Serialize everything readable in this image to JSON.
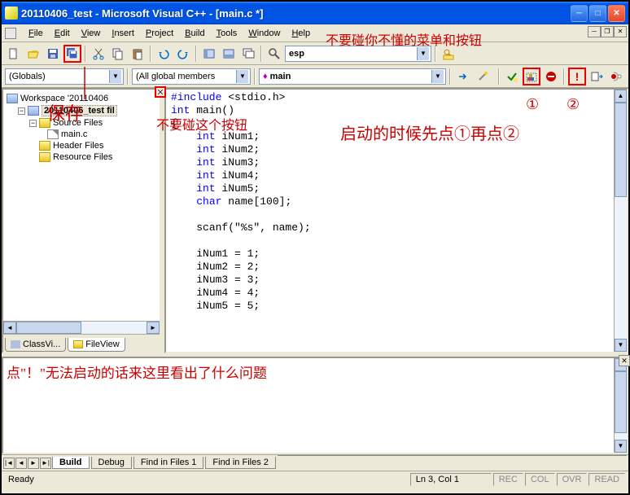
{
  "title": "20110406_test - Microsoft Visual C++ - [main.c *]",
  "menus": [
    "File",
    "Edit",
    "View",
    "Insert",
    "Project",
    "Build",
    "Tools",
    "Window",
    "Help"
  ],
  "annot": {
    "menu_warn": "不要碰你不懂的菜单和按钮",
    "save": "保存",
    "close_warn": "不要碰这个按钮",
    "start_seq": "启动的时候先点①再点②",
    "c1": "①",
    "c2": "②",
    "output_hint": "点\"！\"无法启动的话来这里看出了什么问题"
  },
  "combos": {
    "globals": "(Globals)",
    "members": "(All global members",
    "main": "main",
    "esp": "esp"
  },
  "tree": {
    "workspace": "Workspace '20110406",
    "project": "20110406_test fil",
    "src": "Source Files",
    "mainc": "main.c",
    "hdr": "Header Files",
    "res": "Resource Files"
  },
  "left_tabs": {
    "class": "ClassVi...",
    "file": "FileView"
  },
  "code": {
    "l1a": "#include",
    "l1b": " <stdio.h>",
    "l2a": "int",
    "l2b": " main()",
    "l3": "{",
    "l4a": "int",
    "l4b": " iNum1;",
    "l5a": "int",
    "l5b": " iNum2;",
    "l6a": "int",
    "l6b": " iNum3;",
    "l7a": "int",
    "l7b": " iNum4;",
    "l8a": "int",
    "l8b": " iNum5;",
    "l9a": "char",
    "l9b": " name[100];",
    "l10": "scanf(\"%s\", name);",
    "l11": "iNum1 = 1;",
    "l12": "iNum2 = 2;",
    "l13": "iNum3 = 3;",
    "l14": "iNum4 = 4;",
    "l15": "iNum5 = 5;"
  },
  "out_tabs": [
    "Build",
    "Debug",
    "Find in Files 1",
    "Find in Files 2"
  ],
  "status": {
    "ready": "Ready",
    "pos": "Ln 3, Col 1",
    "rec": "REC",
    "col": "COL",
    "ovr": "OVR",
    "read": "READ"
  }
}
